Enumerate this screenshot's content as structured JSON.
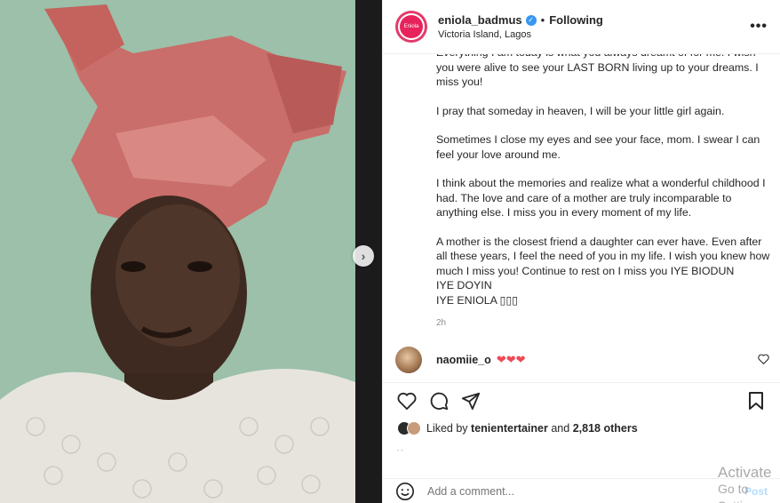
{
  "header": {
    "avatar_text": "Eniola",
    "username": "eniola_badmus",
    "separator": "•",
    "follow_label": "Following",
    "location": "Victoria Island, Lagos",
    "more_icon": "more-horizontal-icon"
  },
  "caption": {
    "paragraphs": [
      "Everything I am today is what you always dreamt of for me. I wish you were alive to see your LAST BORN living up to your dreams. I miss you!",
      "I pray that someday in heaven, I will be your little girl again.",
      "Sometimes I close my eyes and see your face, mom. I swear I can feel your love around me.",
      "I think about the memories and realize what a wonderful childhood I had. The love and care of a mother are truly incomparable to anything else. I miss you in every moment of my life."
    ],
    "last_paragraph_line1": "A mother is the closest friend a daughter can ever have. Even after all these years, I feel the need of you in my life. I wish you knew how much I miss you! Continue to rest on I miss you IYE BIODUN",
    "last_paragraph_line2": "IYE DOYIN",
    "last_paragraph_line3": "IYE ENIOLA ▯▯▯",
    "time": "2h"
  },
  "comment": {
    "username": "naomiie_o",
    "text": "❤❤❤"
  },
  "likes": {
    "prefix": "Liked by ",
    "user": "tenientertainer",
    "middle": " and ",
    "others": "2,818 others"
  },
  "add_comment": {
    "placeholder": "Add a comment...",
    "post_label": "Post"
  },
  "watermark": {
    "line1": "Activate",
    "line2": "Go to Settings"
  },
  "colors": {
    "accent": "#e8235b",
    "verified": "#3897f0",
    "heart": "#ed4956"
  }
}
